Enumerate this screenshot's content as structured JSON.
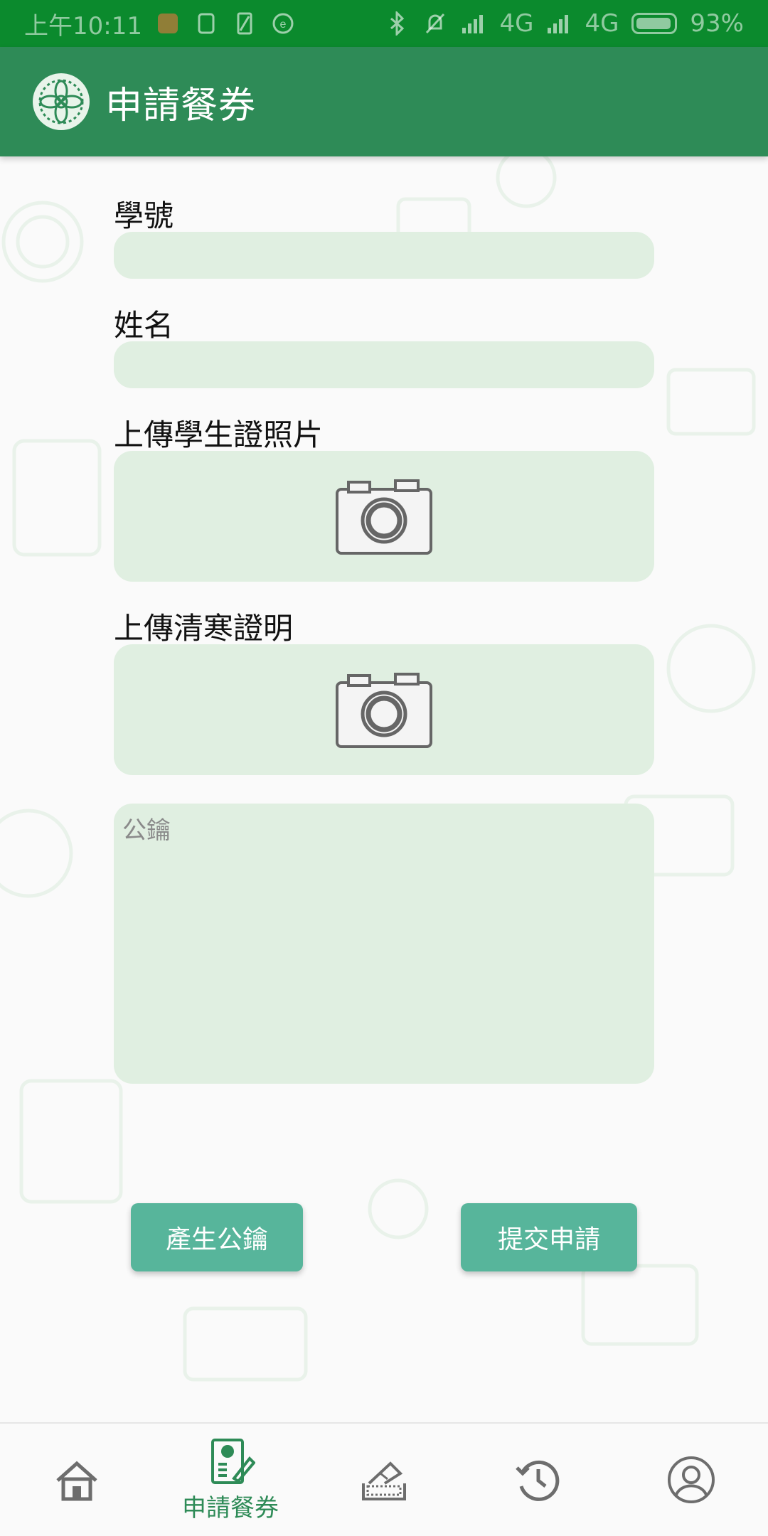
{
  "status_bar": {
    "time": "上午10:11",
    "network_1": "4G",
    "network_2": "4G",
    "battery": "93%",
    "battery_level": 0.93
  },
  "app_bar": {
    "title": "申請餐券",
    "logo_icon": "mandala-logo-icon"
  },
  "form": {
    "student_id_label": "學號",
    "student_id_value": "",
    "name_label": "姓名",
    "name_value": "",
    "student_card_label": "上傳學生證照片",
    "poverty_proof_label": "上傳清寒證明",
    "public_key_placeholder": "公鑰",
    "camera_icon": "camera-icon"
  },
  "buttons": {
    "generate_key": "產生公鑰",
    "submit": "提交申請"
  },
  "bottom_nav": {
    "items": [
      {
        "icon": "home-icon",
        "label": ""
      },
      {
        "icon": "apply-form-icon",
        "label": "申請餐券"
      },
      {
        "icon": "ticket-icon",
        "label": ""
      },
      {
        "icon": "history-icon",
        "label": ""
      },
      {
        "icon": "profile-icon",
        "label": ""
      }
    ]
  },
  "colors": {
    "status_bar": "#0b8a2d",
    "app_bar": "#2e8b57",
    "field_bg": "#e0efe1",
    "button_bg": "#57b59b",
    "nav_active": "#2e8b57"
  }
}
